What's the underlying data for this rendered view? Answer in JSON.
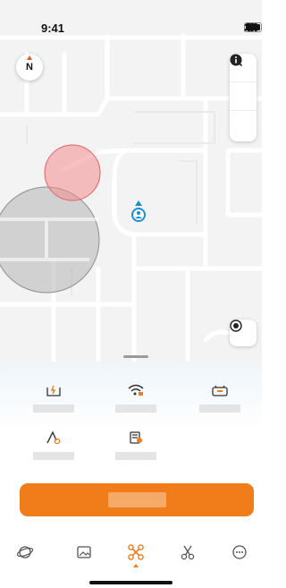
{
  "status_bar": {
    "time": "9:41"
  },
  "compass": {
    "label": "N"
  },
  "colors": {
    "accent": "#f07d1a",
    "marker": "#1a8fd0",
    "zone_red": "#f28c8c",
    "zone_gray": "#b0b0b0"
  },
  "map_tools": [
    {
      "name": "search-icon"
    },
    {
      "name": "layers-icon"
    },
    {
      "name": "info-icon"
    }
  ],
  "telemetry_tiles": [
    {
      "icon": "battery-icon",
      "value": ""
    },
    {
      "icon": "signal-icon",
      "value": ""
    },
    {
      "icon": "controller-icon",
      "value": ""
    },
    {
      "icon": "altitude-icon",
      "value": ""
    },
    {
      "icon": "log-icon",
      "value": ""
    }
  ],
  "primary_action": {
    "label": ""
  },
  "tabs": [
    {
      "icon": "planet-icon"
    },
    {
      "icon": "gallery-icon"
    },
    {
      "icon": "drone-icon",
      "active": true
    },
    {
      "icon": "edit-cut-icon"
    },
    {
      "icon": "more-icon"
    }
  ]
}
